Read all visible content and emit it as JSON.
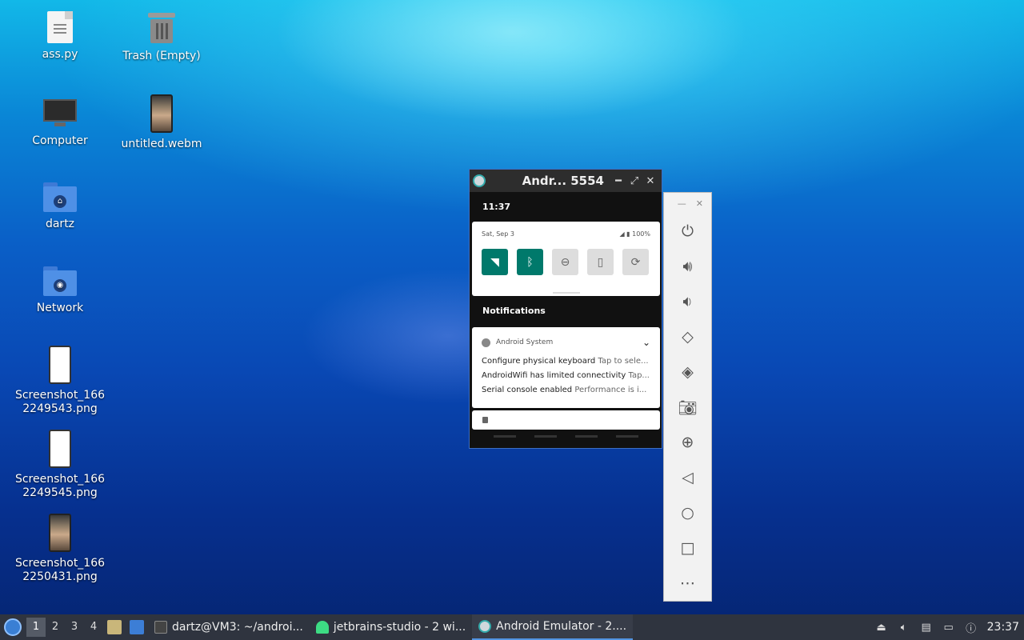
{
  "desktop": {
    "icons": [
      {
        "label": "ass.py"
      },
      {
        "label": "Trash (Empty)"
      },
      {
        "label": "Computer"
      },
      {
        "label": "untitled.webm"
      },
      {
        "label": "dartz"
      },
      {
        "label": "Network"
      },
      {
        "label": "Screenshot_1662249543.png",
        "display": "Screenshot_166\n2249543.png"
      },
      {
        "label": "Screenshot_1662249545.png",
        "display": "Screenshot_166\n2249545.png"
      },
      {
        "label": "Screenshot_1662250431.png",
        "display": "Screenshot_166\n2250431.png"
      }
    ]
  },
  "emulator": {
    "title": "Andr... 5554",
    "status_time": "11:37",
    "quick_settings": {
      "date": "Sat, Sep 3",
      "battery": "100%",
      "tiles": [
        {
          "name": "wifi",
          "state": "on"
        },
        {
          "name": "bluetooth",
          "state": "on"
        },
        {
          "name": "do-not-disturb",
          "state": "off"
        },
        {
          "name": "flashlight",
          "state": "off"
        },
        {
          "name": "auto-rotate",
          "state": "off"
        }
      ]
    },
    "notifications_label": "Notifications",
    "notification": {
      "app": "Android System",
      "rows": [
        {
          "title": "Configure physical keyboard",
          "text": "Tap to sele..."
        },
        {
          "title": "AndroidWifi has limited connectivity",
          "text": "Tap..."
        },
        {
          "title": "Serial console enabled",
          "text": "Performance is i..."
        }
      ]
    }
  },
  "toolbar": {
    "buttons": [
      "power-icon",
      "volume-up-icon",
      "volume-down-icon",
      "rotate-left-icon",
      "rotate-right-icon",
      "camera-icon",
      "zoom-icon",
      "back-icon",
      "home-icon",
      "overview-icon",
      "more-icon"
    ]
  },
  "taskbar": {
    "workspaces": [
      "1",
      "2",
      "3",
      "4"
    ],
    "active_workspace": "1",
    "tasks": [
      {
        "label": "dartz@VM3: ~/androi..."
      },
      {
        "label": "jetbrains-studio - 2 wi..."
      },
      {
        "label": "Android Emulator - 2...."
      }
    ],
    "clock": "23:37"
  }
}
